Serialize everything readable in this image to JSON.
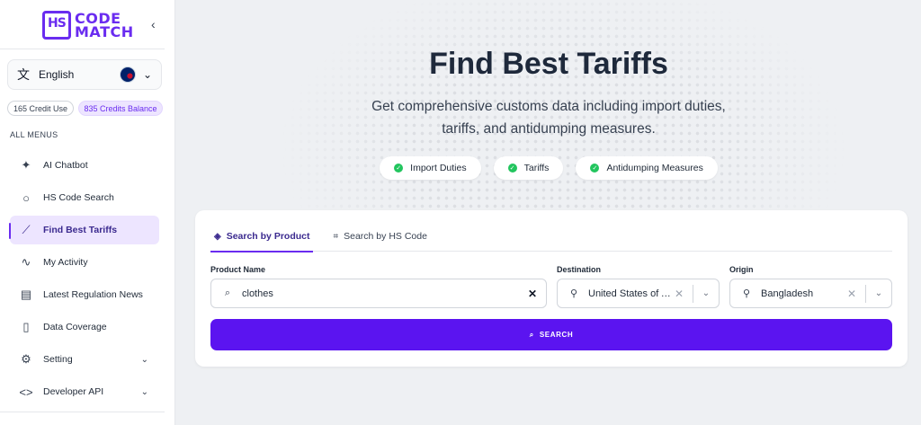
{
  "sidebar": {
    "logo": {
      "line1": "CODE",
      "line2": "MATCH",
      "mark": "HS"
    },
    "language": {
      "label": "English",
      "icon": "translate-icon"
    },
    "credits": {
      "used": "165 Credit Use",
      "balance": "835 Credits Balance"
    },
    "menus_title": "ALL MENUS",
    "items": [
      {
        "label": "AI Chatbot",
        "icon": "sparkle-icon"
      },
      {
        "label": "HS Code Search",
        "icon": "search-icon"
      },
      {
        "label": "Find Best Tariffs",
        "icon": "trend-icon",
        "active": true
      },
      {
        "label": "My Activity",
        "icon": "activity-icon"
      },
      {
        "label": "Latest Regulation News",
        "icon": "news-icon"
      },
      {
        "label": "Data Coverage",
        "icon": "document-icon"
      },
      {
        "label": "Setting",
        "icon": "gear-icon",
        "expandable": true
      },
      {
        "label": "Developer API",
        "icon": "code-icon",
        "expandable": true
      }
    ]
  },
  "hero": {
    "title": "Find Best Tariffs",
    "subtitle": "Get comprehensive customs data including import duties, tariffs, and antidumping measures.",
    "pills": [
      "Import Duties",
      "Tariffs",
      "Antidumping Measures"
    ]
  },
  "search_card": {
    "tabs": [
      {
        "label": "Search by Product",
        "active": true
      },
      {
        "label": "Search by HS Code",
        "active": false
      }
    ],
    "product": {
      "label": "Product Name",
      "value": "clothes"
    },
    "destination": {
      "label": "Destination",
      "value": "United States of A..."
    },
    "origin": {
      "label": "Origin",
      "value": "Bangladesh"
    },
    "button_label": "SEARCH"
  },
  "colors": {
    "accent": "#5b14f0",
    "active_bg": "#ede5ff",
    "success": "#22c55e"
  }
}
